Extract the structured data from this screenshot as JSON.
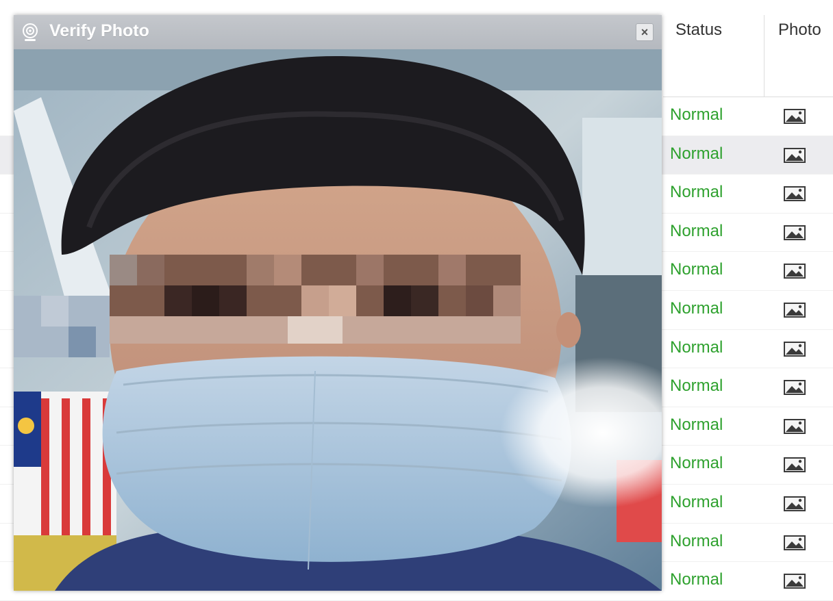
{
  "table": {
    "columns": {
      "status": "Status",
      "photo": "Photo"
    },
    "highlighted_row": 1,
    "status_color": "#2ea12e",
    "rows": [
      {
        "status": "Normal",
        "photo_icon": "image-icon"
      },
      {
        "status": "Normal",
        "photo_icon": "image-icon"
      },
      {
        "status": "Normal",
        "photo_icon": "image-icon"
      },
      {
        "status": "Normal",
        "photo_icon": "image-icon"
      },
      {
        "status": "Normal",
        "photo_icon": "image-icon"
      },
      {
        "status": "Normal",
        "photo_icon": "image-icon"
      },
      {
        "status": "Normal",
        "photo_icon": "image-icon"
      },
      {
        "status": "Normal",
        "photo_icon": "image-icon"
      },
      {
        "status": "Normal",
        "photo_icon": "image-icon"
      },
      {
        "status": "Normal",
        "photo_icon": "image-icon"
      },
      {
        "status": "Normal",
        "photo_icon": "image-icon"
      },
      {
        "status": "Normal",
        "photo_icon": "image-icon"
      },
      {
        "status": "Normal",
        "photo_icon": "image-icon"
      }
    ]
  },
  "dialog": {
    "title": "Verify Photo",
    "title_icon": "camera-icon",
    "close_icon": "close-icon",
    "close_label": "×",
    "photo_icon": "verification-photo"
  }
}
